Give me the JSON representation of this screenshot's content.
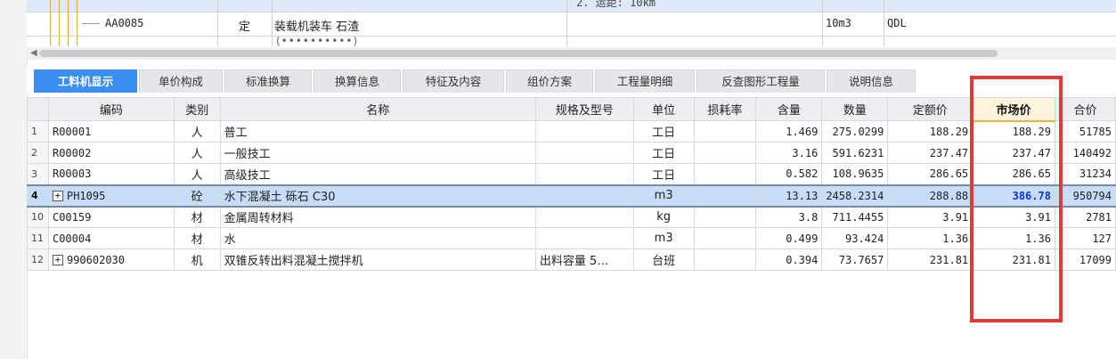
{
  "top_table": {
    "row1_fragment": "2. 运距: 10km",
    "row2": {
      "code": "AA0085",
      "type": "定",
      "name": "装载机装车 石渣",
      "unit": "10m3",
      "flag": "QDL"
    },
    "row3_fragment": "(••••••••••)"
  },
  "tabs": [
    "工料机显示",
    "单价构成",
    "标准换算",
    "换算信息",
    "特征及内容",
    "组价方案",
    "工程量明细",
    "反查图形工程量",
    "说明信息"
  ],
  "columns": [
    "编码",
    "类别",
    "名称",
    "规格及型号",
    "单位",
    "损耗率",
    "含量",
    "数量",
    "定额价",
    "市场价",
    "合价"
  ],
  "rows": [
    {
      "n": "1",
      "code": "R00001",
      "cat": "人",
      "name": "普工",
      "spec": "",
      "unit": "工日",
      "loss": "",
      "qty": "1.469",
      "amount": "275.0299",
      "quota": "188.29",
      "market": "188.29",
      "total": "51785",
      "expand": false,
      "selected": false
    },
    {
      "n": "2",
      "code": "R00002",
      "cat": "人",
      "name": "一般技工",
      "spec": "",
      "unit": "工日",
      "loss": "",
      "qty": "3.16",
      "amount": "591.6231",
      "quota": "237.47",
      "market": "237.47",
      "total": "140492",
      "expand": false,
      "selected": false
    },
    {
      "n": "3",
      "code": "R00003",
      "cat": "人",
      "name": "高级技工",
      "spec": "",
      "unit": "工日",
      "loss": "",
      "qty": "0.582",
      "amount": "108.9635",
      "quota": "286.65",
      "market": "286.65",
      "total": "31234",
      "expand": false,
      "selected": false
    },
    {
      "n": "4",
      "code": "PH1095",
      "cat": "砼",
      "name": "水下混凝土 砾石 C30",
      "spec": "",
      "unit": "m3",
      "loss": "",
      "qty": "13.13",
      "amount": "2458.2314",
      "quota": "288.88",
      "market": "386.78",
      "total": "950794",
      "expand": true,
      "selected": true
    },
    {
      "n": "10",
      "code": "C00159",
      "cat": "材",
      "name": "金属周转材料",
      "spec": "",
      "unit": "kg",
      "loss": "",
      "qty": "3.8",
      "amount": "711.4455",
      "quota": "3.91",
      "market": "3.91",
      "total": "2781",
      "expand": false,
      "selected": false
    },
    {
      "n": "11",
      "code": "C00004",
      "cat": "材",
      "name": "水",
      "spec": "",
      "unit": "m3",
      "loss": "",
      "qty": "0.499",
      "amount": "93.424",
      "quota": "1.36",
      "market": "1.36",
      "total": "127",
      "expand": false,
      "selected": false
    },
    {
      "n": "12",
      "code": "990602030",
      "cat": "机",
      "name": "双锥反转出料混凝土搅拌机",
      "spec": "出料容量 5…",
      "unit": "台班",
      "loss": "",
      "qty": "0.394",
      "amount": "73.7657",
      "quota": "231.81",
      "market": "231.81",
      "total": "17099",
      "expand": true,
      "selected": false
    }
  ],
  "colors": {
    "active_tab": "#3b8ff0",
    "selected_row": "#c7dcf7",
    "highlight_box": "#e53935",
    "market_emphasis": "#1133dd"
  }
}
